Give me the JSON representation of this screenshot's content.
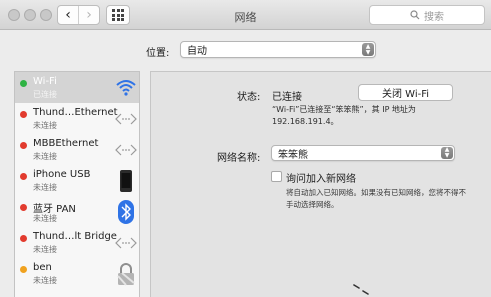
{
  "window": {
    "title": "网络",
    "search_placeholder": "搜索",
    "back_glyph": "‹",
    "forward_glyph": "›"
  },
  "location": {
    "label": "位置:",
    "value": "自动"
  },
  "sidebar": {
    "items": [
      {
        "name": "Wi-Fi",
        "status": "已连接",
        "status_color": "#2fb344",
        "icon": "wifi-icon",
        "selected": true
      },
      {
        "name": "Thund…Ethernet",
        "status": "未连接",
        "status_color": "#e23b2e",
        "icon": "ethernet-arrows-icon"
      },
      {
        "name": "MBBEthernet",
        "status": "未连接",
        "status_color": "#e23b2e",
        "icon": "ethernet-arrows-icon"
      },
      {
        "name": "iPhone USB",
        "status": "未连接",
        "status_color": "#e23b2e",
        "icon": "iphone-icon"
      },
      {
        "name": "蓝牙 PAN",
        "status": "未连接",
        "status_color": "#e23b2e",
        "icon": "bluetooth-icon"
      },
      {
        "name": "Thund…lt Bridge",
        "status": "未连接",
        "status_color": "#e23b2e",
        "icon": "ethernet-arrows-icon"
      },
      {
        "name": "ben",
        "status": "未连接",
        "status_color": "#f0a21f",
        "icon": "lock-icon"
      }
    ]
  },
  "detail": {
    "status_label": "状态:",
    "status_value": "已连接",
    "turn_off_button": "关闭 Wi-Fi",
    "status_description": "“Wi-Fi”已连接至“笨笨熊”，其 IP 地址为 192.168.191.4。",
    "network_name_label": "网络名称:",
    "network_name_value": "笨笨熊",
    "ask_to_join_label": "询问加入新网络",
    "ask_to_join_checked": false,
    "ask_to_join_help": "将自动加入已知网络。如果没有已知网络，您将不得不手动选择网络。"
  },
  "colors": {
    "accent": "#2f73e6",
    "connected": "#2fb344",
    "disconnected": "#e23b2e",
    "inactive": "#f0a21f"
  }
}
